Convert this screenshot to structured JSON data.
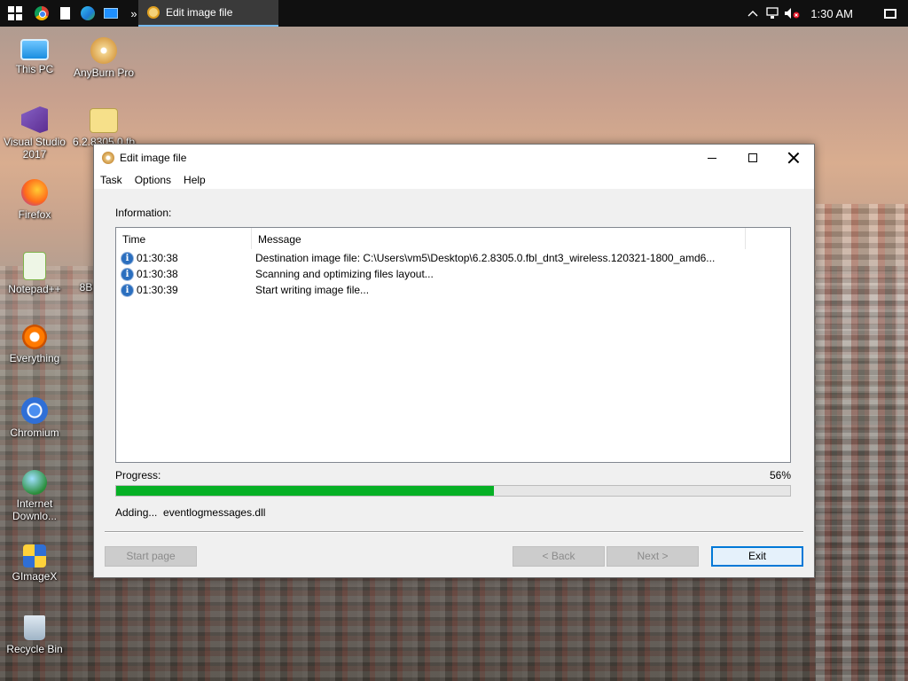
{
  "taskbar": {
    "active_app_title": "Edit image file",
    "overflow_glyph": "»",
    "clock": "1:30 AM"
  },
  "desktop": {
    "icons": [
      {
        "label": "This PC",
        "icon": "computer-icon"
      },
      {
        "label": "AnyBurn Pro",
        "icon": "disc-icon"
      },
      {
        "label": "Visual Studio 2017",
        "icon": "visual-studio-icon"
      },
      {
        "label": "6.2.8305.0.fb",
        "icon": "iso-file-icon"
      },
      {
        "label": "Firefox",
        "icon": "firefox-icon"
      },
      {
        "label": "Notepad++",
        "icon": "notepad-icon"
      },
      {
        "label": "8B",
        "icon": "file-icon"
      },
      {
        "label": "Everything",
        "icon": "search-tool-icon"
      },
      {
        "label": "Chromium",
        "icon": "chromium-icon"
      },
      {
        "label": "Internet Downlo...",
        "icon": "download-manager-icon"
      },
      {
        "label": "GImageX",
        "icon": "imagex-icon"
      },
      {
        "label": "Recycle Bin",
        "icon": "recycle-bin-icon"
      }
    ]
  },
  "window": {
    "title": "Edit image file",
    "menu": [
      "Task",
      "Options",
      "Help"
    ],
    "information_label": "Information:",
    "columns": [
      "Time",
      "Message"
    ],
    "log": [
      {
        "time": "01:30:38",
        "message": "Destination image file:  C:\\Users\\vm5\\Desktop\\6.2.8305.0.fbl_dnt3_wireless.120321-1800_amd6..."
      },
      {
        "time": "01:30:38",
        "message": "Scanning and optimizing files layout..."
      },
      {
        "time": "01:30:39",
        "message": "Start writing image file..."
      }
    ],
    "progress_label": "Progress:",
    "progress_percent_text": "56%",
    "progress_value": 56,
    "status_text": "Adding...  eventlogmessages.dll",
    "buttons": {
      "start_page": "Start page",
      "back": "< Back",
      "next": "Next >",
      "exit": "Exit"
    }
  },
  "colors": {
    "progress_fill": "#06b025",
    "accent": "#0078d7",
    "taskbar_bg": "#101010"
  }
}
